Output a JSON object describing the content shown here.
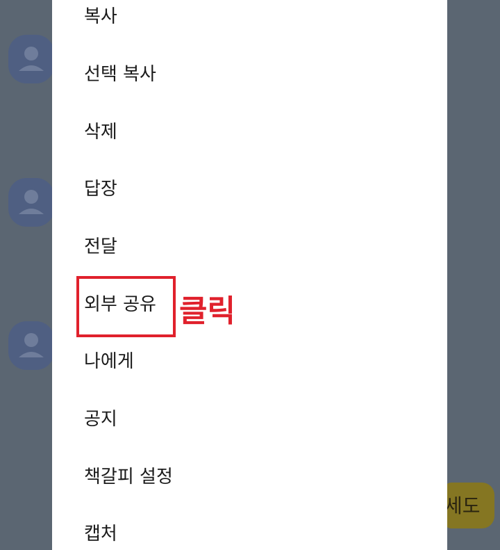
{
  "menu": {
    "items": [
      {
        "label": "복사"
      },
      {
        "label": "선택 복사"
      },
      {
        "label": "삭제"
      },
      {
        "label": "답장"
      },
      {
        "label": "전달"
      },
      {
        "label": "외부 공유"
      },
      {
        "label": "나에게"
      },
      {
        "label": "공지"
      },
      {
        "label": "책갈피 설정"
      },
      {
        "label": "캡처"
      }
    ]
  },
  "annotation": {
    "label": "클릭",
    "color": "#e0212c",
    "target": "외부 공유"
  },
  "chat_background": {
    "partial_message_text": "세도",
    "bubble_color": "#857622",
    "overlay_color": "#5b6672",
    "avatar_icon": "person-icon"
  },
  "colors": {
    "sheet": "#ffffff",
    "text": "#1a1a1a"
  }
}
